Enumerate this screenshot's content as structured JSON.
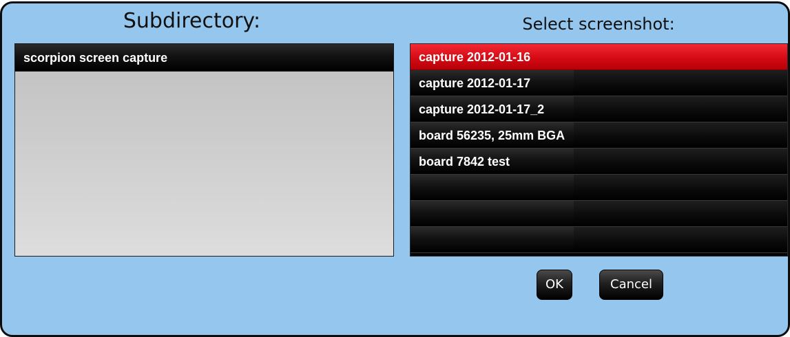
{
  "subdirectory": {
    "heading": "Subdirectory:",
    "items": [
      {
        "label": "scorpion screen capture",
        "selected": false
      }
    ]
  },
  "screenshots": {
    "heading": "Select screenshot:",
    "items": [
      {
        "label": "capture 2012-01-16",
        "selected": true
      },
      {
        "label": "capture 2012-01-17",
        "selected": false
      },
      {
        "label": "capture 2012-01-17_2",
        "selected": false
      },
      {
        "label": "board 56235, 25mm BGA",
        "selected": false
      },
      {
        "label": "board 7842 test",
        "selected": false
      },
      {
        "label": "",
        "selected": false
      },
      {
        "label": "",
        "selected": false
      },
      {
        "label": "",
        "selected": false
      }
    ]
  },
  "buttons": {
    "ok_label": "OK",
    "cancel_label": "Cancel"
  },
  "colors": {
    "background": "#94c6ee",
    "selected_row": "#d40a14",
    "row": "#0a0a0a"
  }
}
